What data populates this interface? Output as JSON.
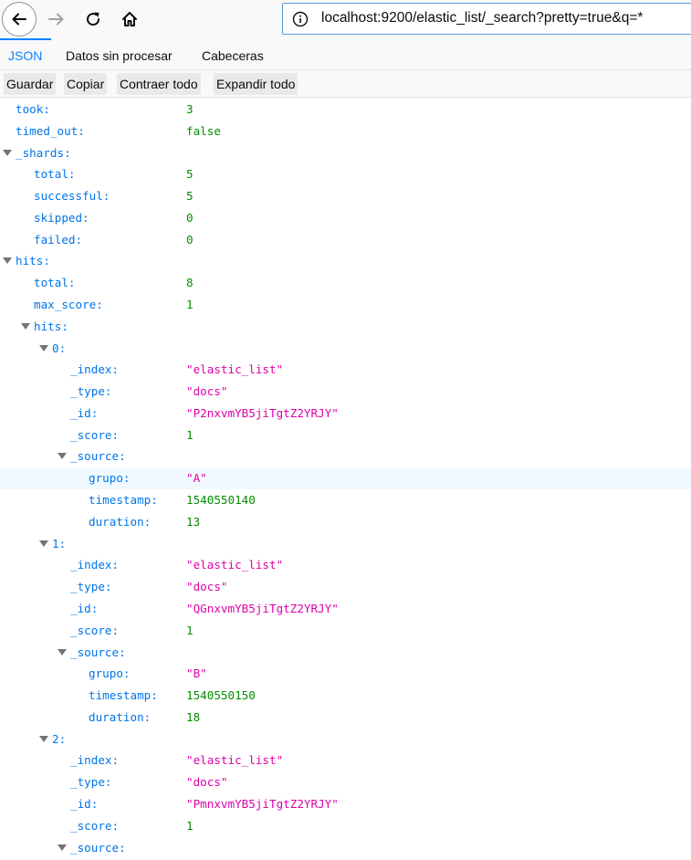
{
  "browser": {
    "url": "localhost:9200/elastic_list/_search?pretty=true&q=*"
  },
  "tabs": [
    {
      "label": "JSON"
    },
    {
      "label": "Datos sin procesar"
    },
    {
      "label": "Cabeceras"
    }
  ],
  "actions": {
    "save": "Guardar",
    "copy": "Copiar",
    "collapse": "Contraer todo",
    "expand": "Expandir todo"
  },
  "tree": [
    {
      "key": "took:",
      "value": "3",
      "type": "num",
      "level": 0
    },
    {
      "key": "timed_out:",
      "value": "false",
      "type": "bool",
      "level": 0
    },
    {
      "key": "_shards:",
      "value": "",
      "type": "obj",
      "level": 0
    },
    {
      "key": "total:",
      "value": "5",
      "type": "num",
      "level": 1
    },
    {
      "key": "successful:",
      "value": "5",
      "type": "num",
      "level": 1
    },
    {
      "key": "skipped:",
      "value": "0",
      "type": "num",
      "level": 1
    },
    {
      "key": "failed:",
      "value": "0",
      "type": "num",
      "level": 1
    },
    {
      "key": "hits:",
      "value": "",
      "type": "obj",
      "level": 0
    },
    {
      "key": "total:",
      "value": "8",
      "type": "num",
      "level": 1
    },
    {
      "key": "max_score:",
      "value": "1",
      "type": "num",
      "level": 1
    },
    {
      "key": "hits:",
      "value": "",
      "type": "obj",
      "level": 1
    },
    {
      "key": "0:",
      "value": "",
      "type": "obj",
      "level": 2
    },
    {
      "key": "_index:",
      "value": "\"elastic_list\"",
      "type": "str",
      "level": 3
    },
    {
      "key": "_type:",
      "value": "\"docs\"",
      "type": "str",
      "level": 3
    },
    {
      "key": "_id:",
      "value": "\"P2nxvmYB5jiTgtZ2YRJY\"",
      "type": "str",
      "level": 3
    },
    {
      "key": "_score:",
      "value": "1",
      "type": "num",
      "level": 3
    },
    {
      "key": "_source:",
      "value": "",
      "type": "obj",
      "level": 3
    },
    {
      "key": "grupo:",
      "value": "\"A\"",
      "type": "str",
      "level": 4,
      "highlight": true
    },
    {
      "key": "timestamp:",
      "value": "1540550140",
      "type": "num",
      "level": 4
    },
    {
      "key": "duration:",
      "value": "13",
      "type": "num",
      "level": 4
    },
    {
      "key": "1:",
      "value": "",
      "type": "obj",
      "level": 2
    },
    {
      "key": "_index:",
      "value": "\"elastic_list\"",
      "type": "str",
      "level": 3
    },
    {
      "key": "_type:",
      "value": "\"docs\"",
      "type": "str",
      "level": 3
    },
    {
      "key": "_id:",
      "value": "\"QGnxvmYB5jiTgtZ2YRJY\"",
      "type": "str",
      "level": 3
    },
    {
      "key": "_score:",
      "value": "1",
      "type": "num",
      "level": 3
    },
    {
      "key": "_source:",
      "value": "",
      "type": "obj",
      "level": 3
    },
    {
      "key": "grupo:",
      "value": "\"B\"",
      "type": "str",
      "level": 4
    },
    {
      "key": "timestamp:",
      "value": "1540550150",
      "type": "num",
      "level": 4
    },
    {
      "key": "duration:",
      "value": "18",
      "type": "num",
      "level": 4
    },
    {
      "key": "2:",
      "value": "",
      "type": "obj",
      "level": 2
    },
    {
      "key": "_index:",
      "value": "\"elastic_list\"",
      "type": "str",
      "level": 3
    },
    {
      "key": "_type:",
      "value": "\"docs\"",
      "type": "str",
      "level": 3
    },
    {
      "key": "_id:",
      "value": "\"PmnxvmYB5jiTgtZ2YRJY\"",
      "type": "str",
      "level": 3
    },
    {
      "key": "_score:",
      "value": "1",
      "type": "num",
      "level": 3
    },
    {
      "key": "_source:",
      "value": "",
      "type": "obj",
      "level": 3
    }
  ]
}
